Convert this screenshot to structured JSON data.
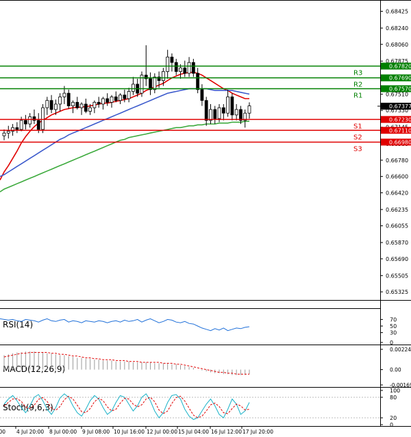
{
  "main": {
    "price_ticks": [
      "0.68425",
      "0.68240",
      "0.68060",
      "0.67875",
      "0.67690",
      "0.67510",
      "0.67330",
      "0.67145",
      "0.66960",
      "0.66780",
      "0.66600",
      "0.66420",
      "0.66235",
      "0.66055",
      "0.65870",
      "0.65690",
      "0.65505",
      "0.65325"
    ],
    "levels": [
      {
        "name": "R3",
        "value": 0.6782,
        "tag": "0.67820",
        "color": "#008000"
      },
      {
        "name": "R2",
        "value": 0.6769,
        "tag": "0.67690",
        "color": "#008000"
      },
      {
        "name": "R1",
        "value": 0.6757,
        "tag": "0.67570",
        "color": "#008000"
      },
      {
        "name": "S1",
        "value": 0.6723,
        "tag": "0.67230",
        "color": "#e00000"
      },
      {
        "name": "S2",
        "value": 0.6711,
        "tag": "0.67110",
        "color": "#e00000"
      },
      {
        "name": "S3",
        "value": 0.6698,
        "tag": "0.66980",
        "color": "#e00000"
      }
    ],
    "current_price": {
      "value": 0.67377,
      "tag": "0.67377"
    }
  },
  "rsi": {
    "label": "RSI(14)",
    "ticks": [
      "70",
      "50",
      "30",
      "0"
    ]
  },
  "macd": {
    "label": "MACD(12,26,9)",
    "ticks": [
      "0.002243",
      "0.00",
      "-0.001697"
    ]
  },
  "stoch": {
    "label": "Stoch(9,6,3)",
    "ticks": [
      "100",
      "80",
      "20",
      "0"
    ]
  },
  "x_ticks": [
    ":00",
    "4 Jul 20:00",
    "8 Jul 00:00",
    "9 Jul 08:00",
    "10 Jul 16:00",
    "12 Jul 00:00",
    "15 Jul 04:00",
    "16 Jul 12:00",
    "17 Jul 20:00"
  ],
  "chart_data": {
    "type": "candlestick",
    "ylim": [
      0.6525,
      0.6852
    ],
    "candles": [
      [
        0.6705,
        0.6712,
        0.67,
        0.6708
      ],
      [
        0.6708,
        0.6716,
        0.6702,
        0.671
      ],
      [
        0.671,
        0.6718,
        0.6705,
        0.6714
      ],
      [
        0.6714,
        0.672,
        0.6708,
        0.6712
      ],
      [
        0.6712,
        0.6726,
        0.671,
        0.6722
      ],
      [
        0.6722,
        0.6728,
        0.6712,
        0.6718
      ],
      [
        0.6718,
        0.673,
        0.6714,
        0.6726
      ],
      [
        0.6726,
        0.6734,
        0.6718,
        0.6722
      ],
      [
        0.6722,
        0.673,
        0.6708,
        0.6712
      ],
      [
        0.6712,
        0.674,
        0.6708,
        0.6736
      ],
      [
        0.6736,
        0.6748,
        0.6728,
        0.6744
      ],
      [
        0.6744,
        0.675,
        0.673,
        0.6734
      ],
      [
        0.6734,
        0.6745,
        0.6728,
        0.674
      ],
      [
        0.674,
        0.6752,
        0.6732,
        0.6748
      ],
      [
        0.6748,
        0.676,
        0.674,
        0.6752
      ],
      [
        0.6752,
        0.6756,
        0.6735,
        0.6738
      ],
      [
        0.6738,
        0.6744,
        0.673,
        0.6742
      ],
      [
        0.6742,
        0.6748,
        0.6734,
        0.6736
      ],
      [
        0.6736,
        0.6742,
        0.6728,
        0.674
      ],
      [
        0.674,
        0.6746,
        0.673,
        0.6732
      ],
      [
        0.6732,
        0.674,
        0.6728,
        0.6736
      ],
      [
        0.6736,
        0.6744,
        0.673,
        0.6742
      ],
      [
        0.6742,
        0.6748,
        0.6736,
        0.674
      ],
      [
        0.674,
        0.6748,
        0.6734,
        0.6746
      ],
      [
        0.6746,
        0.6752,
        0.6738,
        0.6742
      ],
      [
        0.6742,
        0.675,
        0.6736,
        0.6748
      ],
      [
        0.6748,
        0.6754,
        0.6742,
        0.6744
      ],
      [
        0.6744,
        0.6752,
        0.674,
        0.675
      ],
      [
        0.675,
        0.6756,
        0.6742,
        0.6746
      ],
      [
        0.6746,
        0.6758,
        0.6742,
        0.6754
      ],
      [
        0.6754,
        0.677,
        0.675,
        0.6762
      ],
      [
        0.6762,
        0.6768,
        0.6748,
        0.6752
      ],
      [
        0.6752,
        0.6776,
        0.6748,
        0.6772
      ],
      [
        0.6772,
        0.6805,
        0.676,
        0.6768
      ],
      [
        0.6768,
        0.6775,
        0.675,
        0.6756
      ],
      [
        0.6756,
        0.6774,
        0.6752,
        0.677
      ],
      [
        0.677,
        0.6776,
        0.6758,
        0.6766
      ],
      [
        0.6766,
        0.678,
        0.676,
        0.6776
      ],
      [
        0.6776,
        0.68,
        0.6768,
        0.6792
      ],
      [
        0.6792,
        0.6796,
        0.6776,
        0.6786
      ],
      [
        0.6786,
        0.679,
        0.6772,
        0.6776
      ],
      [
        0.6776,
        0.6784,
        0.6768,
        0.678
      ],
      [
        0.678,
        0.6788,
        0.677,
        0.6774
      ],
      [
        0.6774,
        0.6792,
        0.677,
        0.6786
      ],
      [
        0.6786,
        0.679,
        0.677,
        0.6774
      ],
      [
        0.6774,
        0.678,
        0.6752,
        0.6756
      ],
      [
        0.6756,
        0.6762,
        0.6738,
        0.6744
      ],
      [
        0.6744,
        0.6748,
        0.6716,
        0.6722
      ],
      [
        0.6722,
        0.674,
        0.6718,
        0.6734
      ],
      [
        0.6734,
        0.6738,
        0.6718,
        0.6724
      ],
      [
        0.6724,
        0.674,
        0.672,
        0.6736
      ],
      [
        0.6736,
        0.674,
        0.6722,
        0.673
      ],
      [
        0.673,
        0.6756,
        0.6726,
        0.6748
      ],
      [
        0.6748,
        0.6752,
        0.6722,
        0.6728
      ],
      [
        0.6728,
        0.674,
        0.6722,
        0.6734
      ],
      [
        0.6734,
        0.6738,
        0.6718,
        0.6722
      ],
      [
        0.6722,
        0.6734,
        0.6714,
        0.673
      ],
      [
        0.673,
        0.6742,
        0.6724,
        0.6738
      ]
    ],
    "series": [
      {
        "name": "MA fast",
        "color": "#e00000",
        "values": [
          0.6665,
          0.6672,
          0.668,
          0.6688,
          0.6697,
          0.6704,
          0.671,
          0.6715,
          0.6719,
          0.6722,
          0.6725,
          0.6728,
          0.673,
          0.6732,
          0.6734,
          0.6735,
          0.6736,
          0.6736,
          0.6737,
          0.6737,
          0.6738,
          0.6739,
          0.674,
          0.6741,
          0.6741,
          0.6742,
          0.6743,
          0.6744,
          0.6745,
          0.6746,
          0.6748,
          0.675,
          0.6752,
          0.6755,
          0.6757,
          0.6759,
          0.6761,
          0.6763,
          0.6766,
          0.6769,
          0.6771,
          0.6773,
          0.6774,
          0.6775,
          0.6775,
          0.6774,
          0.6772,
          0.6769,
          0.6766,
          0.6763,
          0.676,
          0.6757,
          0.6755,
          0.6752,
          0.675,
          0.6748,
          0.6746,
          0.6746
        ]
      },
      {
        "name": "MA mid",
        "color": "#3c5acc",
        "values": [
          0.6662,
          0.6665,
          0.6668,
          0.6671,
          0.6674,
          0.6677,
          0.668,
          0.6683,
          0.6686,
          0.6689,
          0.6692,
          0.6695,
          0.6698,
          0.6701,
          0.6703,
          0.6706,
          0.6708,
          0.671,
          0.6712,
          0.6714,
          0.6716,
          0.6718,
          0.672,
          0.6722,
          0.6724,
          0.6726,
          0.6728,
          0.673,
          0.6732,
          0.6734,
          0.6736,
          0.6738,
          0.674,
          0.6742,
          0.6744,
          0.6746,
          0.6748,
          0.675,
          0.6752,
          0.6753,
          0.6754,
          0.6755,
          0.6756,
          0.6757,
          0.6757,
          0.6757,
          0.6757,
          0.6757,
          0.6756,
          0.6755,
          0.6755,
          0.6755,
          0.6755,
          0.6755,
          0.6754,
          0.6753,
          0.6752,
          0.6751
        ]
      },
      {
        "name": "MA slow",
        "color": "#3caa3c",
        "values": [
          0.6646,
          0.6648,
          0.665,
          0.6652,
          0.6654,
          0.6656,
          0.6658,
          0.666,
          0.6662,
          0.6664,
          0.6666,
          0.6668,
          0.667,
          0.6672,
          0.6674,
          0.6676,
          0.6678,
          0.668,
          0.6682,
          0.6684,
          0.6686,
          0.6688,
          0.669,
          0.6692,
          0.6694,
          0.6696,
          0.6698,
          0.67,
          0.6701,
          0.6703,
          0.6704,
          0.6705,
          0.6706,
          0.6707,
          0.6708,
          0.6709,
          0.671,
          0.6711,
          0.6712,
          0.6713,
          0.6714,
          0.6714,
          0.6715,
          0.6716,
          0.6716,
          0.6717,
          0.6717,
          0.6718,
          0.6718,
          0.6718,
          0.6719,
          0.6719,
          0.6719,
          0.672,
          0.672,
          0.672,
          0.6721,
          0.6721
        ]
      }
    ],
    "rsi_values": [
      72,
      68,
      70,
      66,
      64,
      70,
      68,
      66,
      62,
      68,
      72,
      66,
      64,
      68,
      70,
      62,
      66,
      64,
      60,
      66,
      64,
      62,
      66,
      64,
      60,
      64,
      66,
      62,
      68,
      64,
      66,
      70,
      62,
      68,
      72,
      66,
      60,
      64,
      70,
      68,
      62,
      60,
      64,
      58,
      56,
      50,
      44,
      40,
      36,
      42,
      38,
      44,
      36,
      40,
      44,
      42,
      46,
      48
    ],
    "macd_values": [
      0.0016,
      0.0017,
      0.0018,
      0.0019,
      0.0019,
      0.002,
      0.002,
      0.002,
      0.0019,
      0.0019,
      0.0018,
      0.0018,
      0.0017,
      0.0016,
      0.0016,
      0.0015,
      0.0014,
      0.0013,
      0.0013,
      0.0012,
      0.0012,
      0.0011,
      0.0011,
      0.001,
      0.001,
      0.001,
      0.0009,
      0.0009,
      0.0009,
      0.0009,
      0.0008,
      0.0008,
      0.0008,
      0.0008,
      0.0008,
      0.0007,
      0.0007,
      0.0007,
      0.0007,
      0.0006,
      0.0006,
      0.0005,
      0.0004,
      0.0003,
      0.0002,
      0.0,
      -0.0001,
      -0.0002,
      -0.0003,
      -0.0004,
      -0.0004,
      -0.0005,
      -0.0005,
      -0.0006,
      -0.0006,
      -0.0006,
      -0.0006,
      -0.0005
    ],
    "macd_signal": [
      0.0014,
      0.0015,
      0.0016,
      0.0017,
      0.0018,
      0.0018,
      0.0019,
      0.0019,
      0.0019,
      0.0019,
      0.0019,
      0.0018,
      0.0018,
      0.0017,
      0.0017,
      0.0016,
      0.0015,
      0.0015,
      0.0014,
      0.0013,
      0.0013,
      0.0012,
      0.0012,
      0.0011,
      0.0011,
      0.0011,
      0.001,
      0.001,
      0.001,
      0.0009,
      0.0009,
      0.0009,
      0.0008,
      0.0008,
      0.0008,
      0.0008,
      0.0008,
      0.0007,
      0.0007,
      0.0007,
      0.0006,
      0.0006,
      0.0005,
      0.0004,
      0.0003,
      0.0002,
      0.0001,
      0.0,
      -0.0001,
      -0.0002,
      -0.0003,
      -0.0003,
      -0.0004,
      -0.0004,
      -0.0005,
      -0.0005,
      -0.0005,
      -0.0005
    ],
    "stoch_k": [
      60,
      75,
      85,
      70,
      50,
      35,
      55,
      80,
      88,
      70,
      45,
      30,
      50,
      78,
      90,
      80,
      55,
      35,
      25,
      45,
      70,
      85,
      75,
      50,
      30,
      40,
      65,
      85,
      80,
      60,
      40,
      55,
      80,
      90,
      70,
      40,
      20,
      35,
      65,
      85,
      88,
      75,
      45,
      25,
      15,
      20,
      40,
      60,
      75,
      55,
      30,
      20,
      45,
      75,
      60,
      30,
      40,
      65
    ],
    "stoch_d": [
      55,
      65,
      75,
      76,
      68,
      52,
      47,
      57,
      74,
      79,
      68,
      48,
      42,
      53,
      73,
      83,
      75,
      57,
      38,
      35,
      47,
      67,
      77,
      70,
      52,
      40,
      45,
      63,
      77,
      75,
      60,
      52,
      58,
      75,
      80,
      67,
      43,
      32,
      40,
      62,
      79,
      83,
      69,
      48,
      28,
      20,
      25,
      40,
      58,
      63,
      53,
      35,
      32,
      47,
      60,
      55,
      43,
      45
    ]
  }
}
